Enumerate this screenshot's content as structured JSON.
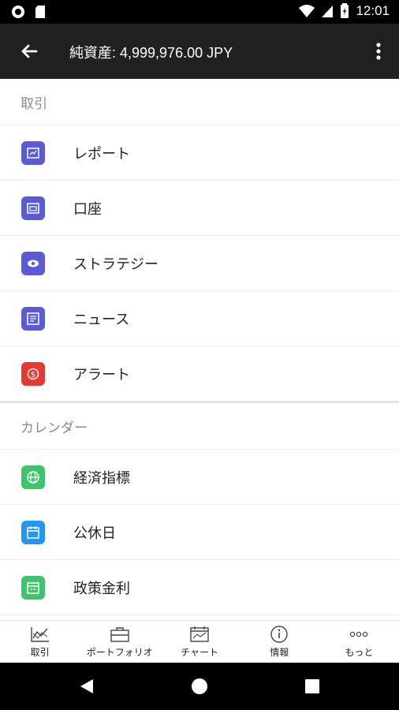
{
  "status_bar": {
    "time": "12:01"
  },
  "app_bar": {
    "title": "純資産: 4,999,976.00 JPY"
  },
  "sections": [
    {
      "header": "取引",
      "items": [
        {
          "label": "レポート",
          "icon": "report-icon",
          "color": "#5b5bd6"
        },
        {
          "label": "口座",
          "icon": "account-icon",
          "color": "#5b5bd6"
        },
        {
          "label": "ストラテジー",
          "icon": "strategy-icon",
          "color": "#5b5bd6"
        },
        {
          "label": "ニュース",
          "icon": "news-icon",
          "color": "#5b5bd6"
        },
        {
          "label": "アラート",
          "icon": "alert-icon",
          "color": "#e53935"
        }
      ]
    },
    {
      "header": "カレンダー",
      "items": [
        {
          "label": "経済指標",
          "icon": "globe-icon",
          "color": "#3ec46d"
        },
        {
          "label": "公休日",
          "icon": "calendar-icon",
          "color": "#2196f3"
        },
        {
          "label": "政策金利",
          "icon": "rates-icon",
          "color": "#3ec46d"
        }
      ]
    }
  ],
  "bottom_nav": [
    {
      "label": "取引",
      "icon": "trade-chart-icon"
    },
    {
      "label": "ポートフォリオ",
      "icon": "briefcase-icon"
    },
    {
      "label": "チャート",
      "icon": "chart-calendar-icon"
    },
    {
      "label": "情報",
      "icon": "info-icon"
    },
    {
      "label": "もっと",
      "icon": "more-icon"
    }
  ]
}
